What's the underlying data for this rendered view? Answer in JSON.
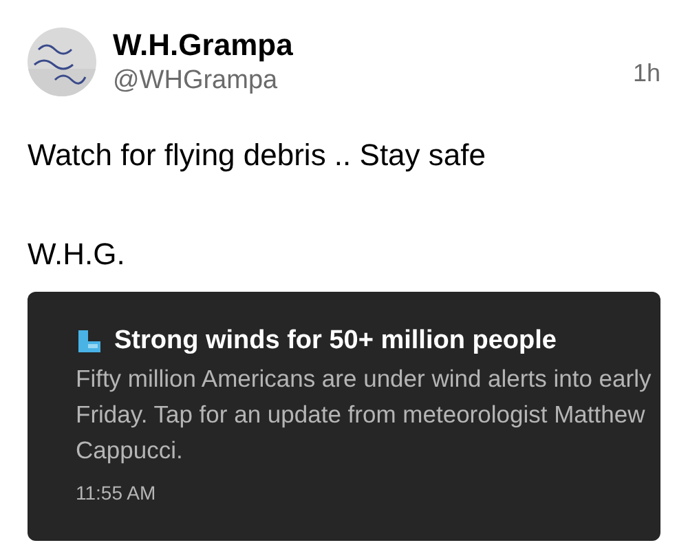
{
  "post": {
    "author": "W.H.Grampa",
    "handle": "@WHGrampa",
    "time": "1h",
    "paragraphs": [
      "Watch for flying debris .. Stay safe",
      "W.H.G."
    ],
    "attachment": {
      "title": "Strong winds for 50+ million people",
      "body": "Fifty million Americans are under wind alerts into early Friday. Tap for an update from meteorologist Matthew Cappucci.",
      "time": "11:55 AM"
    }
  }
}
